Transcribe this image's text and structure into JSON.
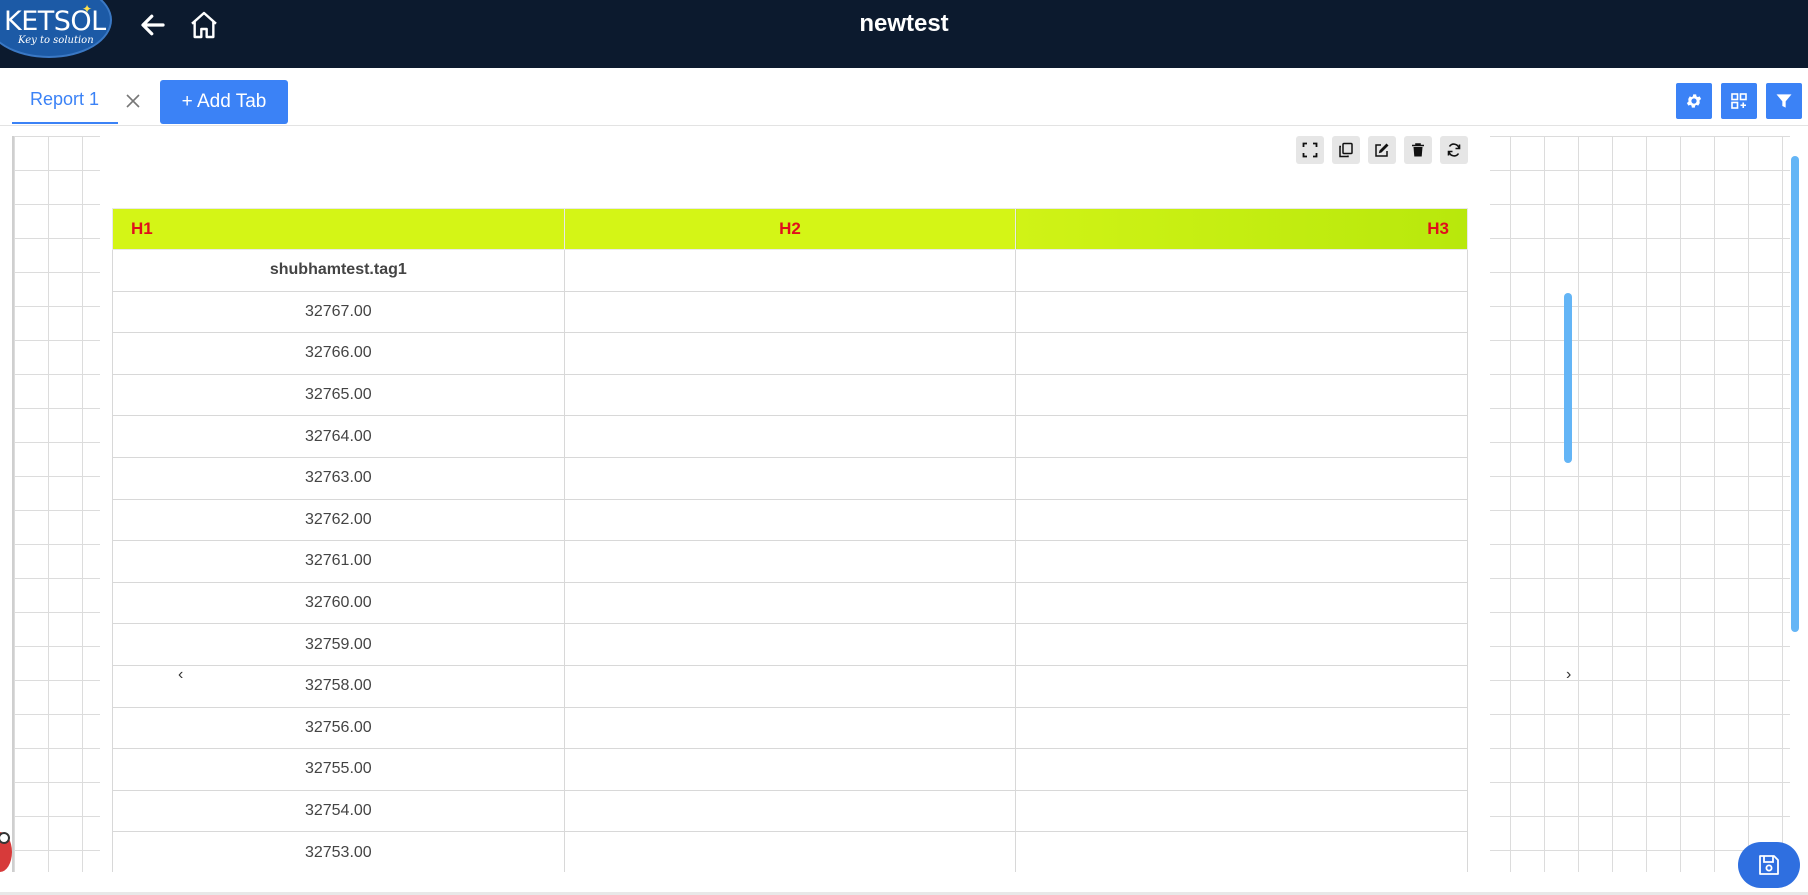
{
  "header": {
    "title": "newtest",
    "logo_text": "KETSOL",
    "logo_tagline": "Key to solution",
    "back_icon": "arrow-left-icon",
    "home_icon": "home-icon"
  },
  "tabs": {
    "items": [
      {
        "label": "Report 1",
        "active": true
      }
    ],
    "add_label": "+ Add Tab",
    "toolbar_icons": [
      "gear-icon",
      "grid-layout-icon",
      "filter-icon"
    ]
  },
  "widget": {
    "toolbar_icons": [
      "fullscreen-icon",
      "copy-icon",
      "edit-icon",
      "delete-icon",
      "refresh-icon"
    ],
    "table": {
      "headers": [
        "H1",
        "H2",
        "H3"
      ],
      "tag_row": [
        "shubhamtest.tag1",
        "",
        ""
      ],
      "rows": [
        [
          "32767.00",
          "",
          ""
        ],
        [
          "32766.00",
          "",
          ""
        ],
        [
          "32765.00",
          "",
          ""
        ],
        [
          "32764.00",
          "",
          ""
        ],
        [
          "32763.00",
          "",
          ""
        ],
        [
          "32762.00",
          "",
          ""
        ],
        [
          "32761.00",
          "",
          ""
        ],
        [
          "32760.00",
          "",
          ""
        ],
        [
          "32759.00",
          "",
          ""
        ],
        [
          "32758.00",
          "",
          ""
        ],
        [
          "32756.00",
          "",
          ""
        ],
        [
          "32755.00",
          "",
          ""
        ],
        [
          "32754.00",
          "",
          ""
        ],
        [
          "32753.00",
          "",
          ""
        ]
      ]
    },
    "prev_arrow": "‹",
    "next_arrow": "›"
  },
  "colors": {
    "topbar": "#0c1a2e",
    "accent": "#3b82f6",
    "header_bg": "#d4f516",
    "header_text": "#e0101c"
  }
}
